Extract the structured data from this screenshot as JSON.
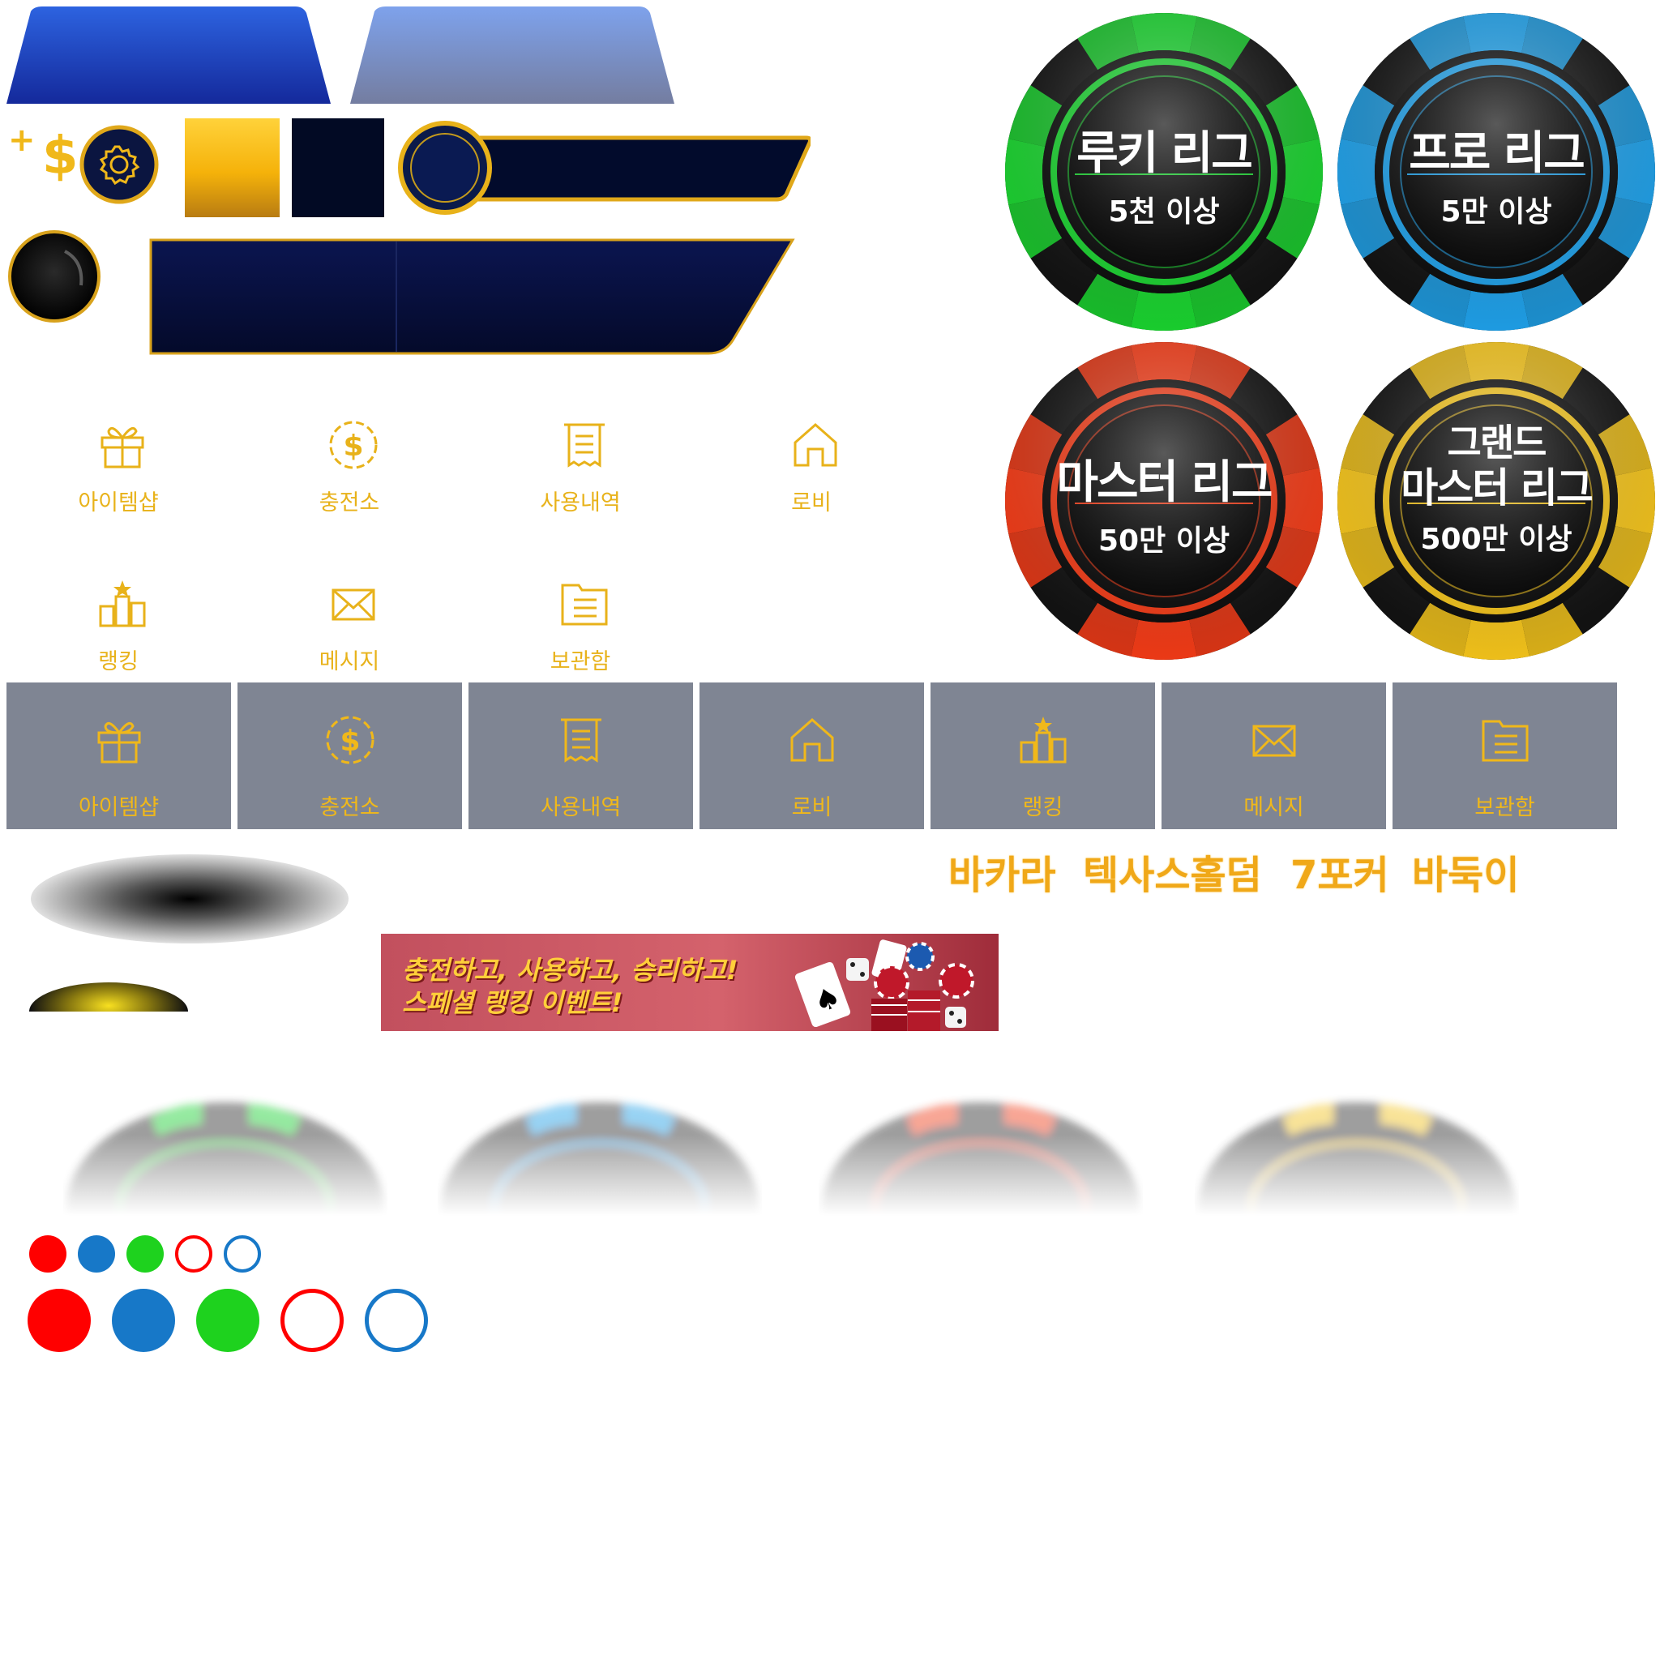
{
  "top_tabs": {
    "tab_active": "",
    "tab_inactive": ""
  },
  "hud": {
    "plus_symbol": "+",
    "currency_symbol": "$"
  },
  "menu_grid": [
    {
      "label": "아이템샵",
      "icon": "gift-icon"
    },
    {
      "label": "충전소",
      "icon": "dollar-coin-icon"
    },
    {
      "label": "사용내역",
      "icon": "receipt-icon"
    },
    {
      "label": "로비",
      "icon": "home-icon"
    },
    {
      "label": "랭킹",
      "icon": "podium-icon"
    },
    {
      "label": "메시지",
      "icon": "envelope-icon"
    },
    {
      "label": "보관함",
      "icon": "folder-icon"
    }
  ],
  "nav_bar": [
    {
      "label": "아이템샵",
      "icon": "gift-icon"
    },
    {
      "label": "충전소",
      "icon": "dollar-coin-icon"
    },
    {
      "label": "사용내역",
      "icon": "receipt-icon"
    },
    {
      "label": "로비",
      "icon": "home-icon"
    },
    {
      "label": "랭킹",
      "icon": "podium-icon"
    },
    {
      "label": "메시지",
      "icon": "envelope-icon"
    },
    {
      "label": "보관함",
      "icon": "folder-icon"
    }
  ],
  "leagues": [
    {
      "title": "루키 리그",
      "threshold": "5천 이상",
      "color": "#19d02e"
    },
    {
      "title": "프로 리그",
      "threshold": "5만 이상",
      "color": "#1e9ee6"
    },
    {
      "title": "마스터 리그",
      "threshold": "50만 이상",
      "color": "#f03a16"
    },
    {
      "title_line1": "그랜드",
      "title_line2": "마스터 리그",
      "threshold": "500만 이상",
      "color": "#f2c21a"
    }
  ],
  "game_tabs": [
    "바카라",
    "텍사스홀덤",
    "7포커",
    "바둑이"
  ],
  "banner": {
    "line1": "충전하고, 사용하고, 승리하고!",
    "line2": "스페셜 랭킹 이벤트!"
  },
  "status_dots": {
    "red": "#ff0000",
    "blue": "#1778c8",
    "green": "#1ed21e"
  },
  "colors": {
    "gold": "#e8b21a",
    "navy": "#0a1440",
    "tile_gray": "#7f8593"
  }
}
